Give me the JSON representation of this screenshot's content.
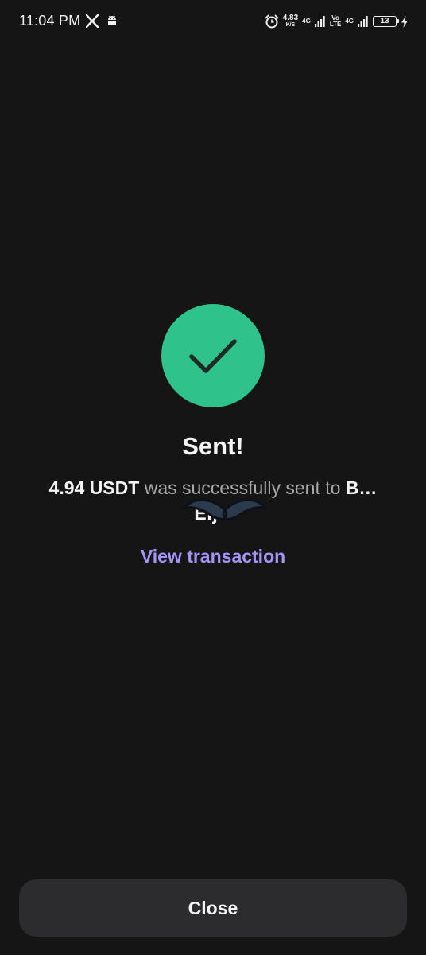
{
  "status_bar": {
    "time": "11:04 PM",
    "speed_value": "4.83",
    "speed_unit": "K/S",
    "network_1": "4G",
    "network_2_top": "Vo",
    "network_2_bottom": "LTE",
    "network_3": "4G",
    "battery": "13",
    "icons": [
      "x-icon",
      "android-icon",
      "alarm-icon",
      "signal-icon",
      "battery-icon",
      "charging-bolt-icon"
    ]
  },
  "success": {
    "icon": "checkmark-icon",
    "title": "Sent!",
    "amount": "4.94 USDT",
    "message_mid": " was successfully sent to ",
    "recipient": "B…Efjw",
    "link_label": "View transaction"
  },
  "footer": {
    "close_label": "Close"
  },
  "colors": {
    "background": "#151515",
    "success_green": "#2fc28a",
    "link_purple": "#a594f7",
    "button_bg": "#2c2c2e"
  }
}
